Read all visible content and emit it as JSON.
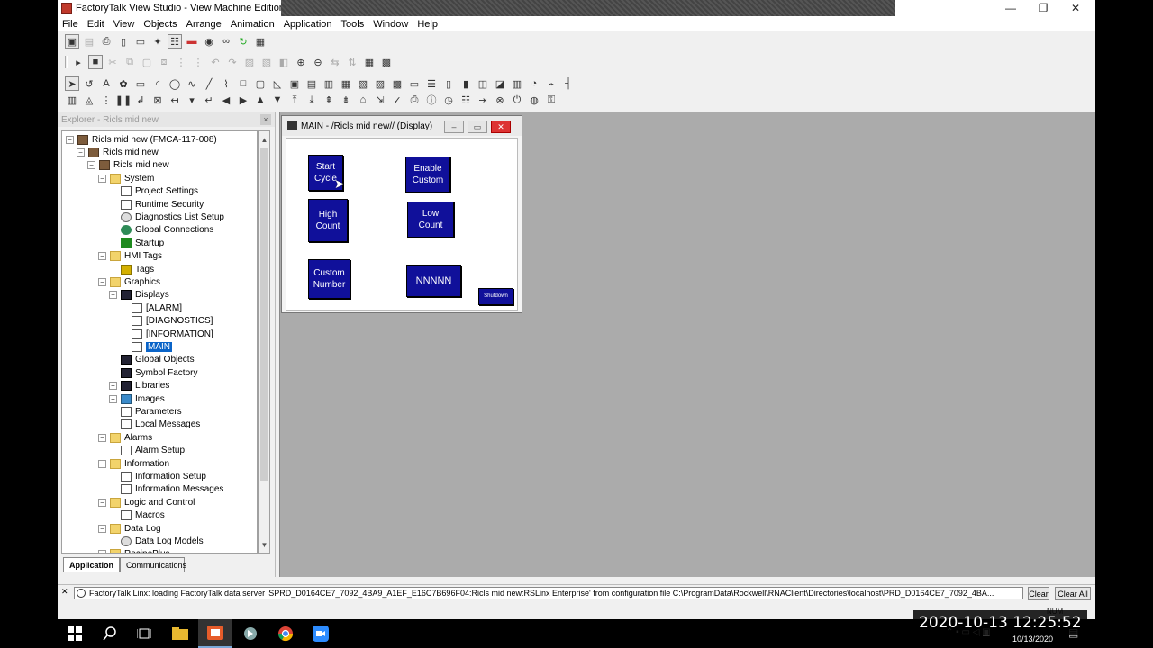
{
  "window": {
    "title": "FactoryTalk View Studio - View Machine Edition",
    "minimize": "—",
    "restore": "❐",
    "close": "✕"
  },
  "menu": [
    "File",
    "Edit",
    "View",
    "Objects",
    "Arrange",
    "Animation",
    "Application",
    "Tools",
    "Window",
    "Help"
  ],
  "explorer": {
    "header": "Explorer - Ricls mid new",
    "close": "×",
    "tree": [
      {
        "label": "Ricls mid new (FMCA-117-008)",
        "level": 0,
        "icon": "computer-icon",
        "exp": "−"
      },
      {
        "label": "Ricls mid new",
        "level": 1,
        "icon": "application-icon",
        "exp": "−"
      },
      {
        "label": "Ricls mid new",
        "level": 2,
        "icon": "project-icon",
        "exp": "−"
      },
      {
        "label": "System",
        "level": 3,
        "icon": "folder-icon",
        "exp": "−"
      },
      {
        "label": "Project Settings",
        "level": 4,
        "icon": "document-icon",
        "exp": ""
      },
      {
        "label": "Runtime Security",
        "level": 4,
        "icon": "document-icon",
        "exp": ""
      },
      {
        "label": "Diagnostics List Setup",
        "level": 4,
        "icon": "gear-icon",
        "exp": ""
      },
      {
        "label": "Global Connections",
        "level": 4,
        "icon": "globe-icon",
        "exp": ""
      },
      {
        "label": "Startup",
        "level": 4,
        "icon": "flag-icon",
        "exp": ""
      },
      {
        "label": "HMI Tags",
        "level": 3,
        "icon": "folder-icon",
        "exp": "−"
      },
      {
        "label": "Tags",
        "level": 4,
        "icon": "tag-icon",
        "exp": ""
      },
      {
        "label": "Graphics",
        "level": 3,
        "icon": "folder-icon",
        "exp": "−"
      },
      {
        "label": "Displays",
        "level": 4,
        "icon": "display-icon",
        "exp": "−"
      },
      {
        "label": "[ALARM]",
        "level": 5,
        "icon": "document-icon",
        "exp": ""
      },
      {
        "label": "[DIAGNOSTICS]",
        "level": 5,
        "icon": "document-icon",
        "exp": ""
      },
      {
        "label": "[INFORMATION]",
        "level": 5,
        "icon": "document-icon",
        "exp": ""
      },
      {
        "label": "MAIN",
        "level": 5,
        "icon": "document-icon",
        "exp": "",
        "selected": true
      },
      {
        "label": "Global Objects",
        "level": 4,
        "icon": "display-icon",
        "exp": ""
      },
      {
        "label": "Symbol Factory",
        "level": 4,
        "icon": "display-icon",
        "exp": ""
      },
      {
        "label": "Libraries",
        "level": 4,
        "icon": "display-icon",
        "exp": "+"
      },
      {
        "label": "Images",
        "level": 4,
        "icon": "image-icon",
        "exp": "+"
      },
      {
        "label": "Parameters",
        "level": 4,
        "icon": "document-icon",
        "exp": ""
      },
      {
        "label": "Local Messages",
        "level": 4,
        "icon": "document-icon",
        "exp": ""
      },
      {
        "label": "Alarms",
        "level": 3,
        "icon": "folder-icon",
        "exp": "−"
      },
      {
        "label": "Alarm Setup",
        "level": 4,
        "icon": "document-icon",
        "exp": ""
      },
      {
        "label": "Information",
        "level": 3,
        "icon": "folder-icon",
        "exp": "−"
      },
      {
        "label": "Information Setup",
        "level": 4,
        "icon": "document-icon",
        "exp": ""
      },
      {
        "label": "Information Messages",
        "level": 4,
        "icon": "document-icon",
        "exp": ""
      },
      {
        "label": "Logic and Control",
        "level": 3,
        "icon": "folder-icon",
        "exp": "−"
      },
      {
        "label": "Macros",
        "level": 4,
        "icon": "document-icon",
        "exp": ""
      },
      {
        "label": "Data Log",
        "level": 3,
        "icon": "folder-icon",
        "exp": "−"
      },
      {
        "label": "Data Log Models",
        "level": 4,
        "icon": "gear-icon",
        "exp": ""
      },
      {
        "label": "RecipePlus",
        "level": 3,
        "icon": "folder-icon",
        "exp": "−"
      }
    ],
    "tabs": {
      "application": "Application",
      "communications": "Communications"
    }
  },
  "display": {
    "title": "MAIN - /Ricls mid new// (Display)",
    "buttons": {
      "start_cycle": "Start\nCycle",
      "enable_custom": "Enable\nCustom",
      "high_count": "High\nCount",
      "low_count": "Low\nCount",
      "custom_number": "Custom\nNumber",
      "numeric": "NNNNN",
      "shutdown": "Shutdown"
    }
  },
  "status": {
    "message": "FactoryTalk Linx: loading FactoryTalk data server 'SPRD_D0164CE7_7092_4BA9_A1EF_E16C7B696F04:Ricls mid new:RSLinx Enterprise' from configuration file C:\\ProgramData\\Rockwell\\RNAClient\\Directories\\localhost\\PRD_D0164CE7_7092_4BA...",
    "clear": "Clear",
    "clear_all": "Clear All",
    "num": "NUM"
  },
  "overlay": {
    "timestamp": "2020-10-13  12:25:52",
    "taskbar_date": "10/13/2020"
  },
  "colors": {
    "hmi_button": "#10109a",
    "workspace": "#ababab",
    "selection": "#0a64c8"
  }
}
